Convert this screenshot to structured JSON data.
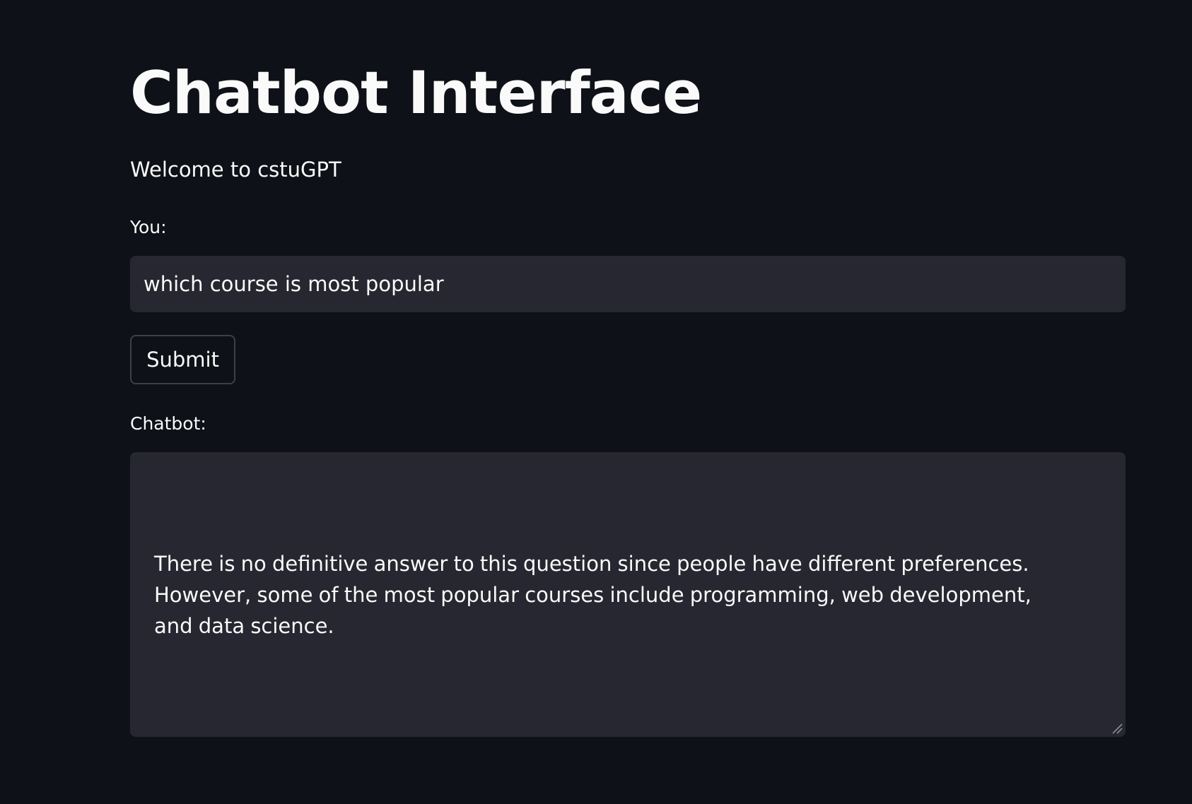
{
  "title": "Chatbot Interface",
  "welcome": "Welcome to cstuGPT",
  "you_label": "You:",
  "user_input": {
    "value": "which course is most popular",
    "placeholder": ""
  },
  "submit_label": "Submit",
  "chatbot_label": "Chatbot:",
  "chatbot_response": "There is no definitive answer to this question since people have different preferences. However, some of the most popular courses include programming, web development, and data science.",
  "icons": {
    "resize": "resize-handle-icon"
  },
  "colors": {
    "background": "#0e1117",
    "input_background": "#262730",
    "text": "#fafafa",
    "button_border": "#3d4048"
  }
}
